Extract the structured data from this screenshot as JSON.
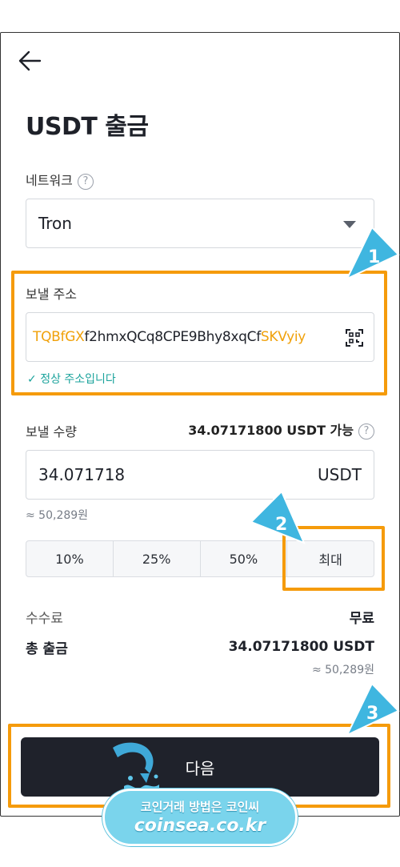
{
  "page_title": "USDT 출금",
  "network": {
    "label": "네트워크",
    "help": "?",
    "selected": "Tron"
  },
  "address": {
    "label": "보낼 주소",
    "prefix": "TQBfGX",
    "middle": "f2hmxQCq8CPE9Bhy8xqCf",
    "suffix": "SKVyiy",
    "valid_text": "정상 주소입니다"
  },
  "amount": {
    "label": "보낼 수량",
    "available": "34.07171800 USDT 가능",
    "help": "?",
    "value": "34.071718",
    "unit": "USDT",
    "approx": "≈ 50,289원"
  },
  "percent_buttons": [
    "10%",
    "25%",
    "50%",
    "최대"
  ],
  "fee": {
    "label": "수수료",
    "value": "무료"
  },
  "total": {
    "label": "총 출금",
    "value": "34.07171800 USDT",
    "approx": "≈ 50,289원"
  },
  "next_button": "다음",
  "markers": [
    "1",
    "2",
    "3"
  ],
  "watermark": {
    "line1": "코인거래 방법은 코인씨",
    "line2": "coinsea.co.kr"
  },
  "colors": {
    "highlight": "#f59b0b",
    "address_accent": "#f0a10a",
    "valid": "#1ba39c",
    "marker": "#3fb6e0",
    "button_bg": "#1f222b"
  }
}
